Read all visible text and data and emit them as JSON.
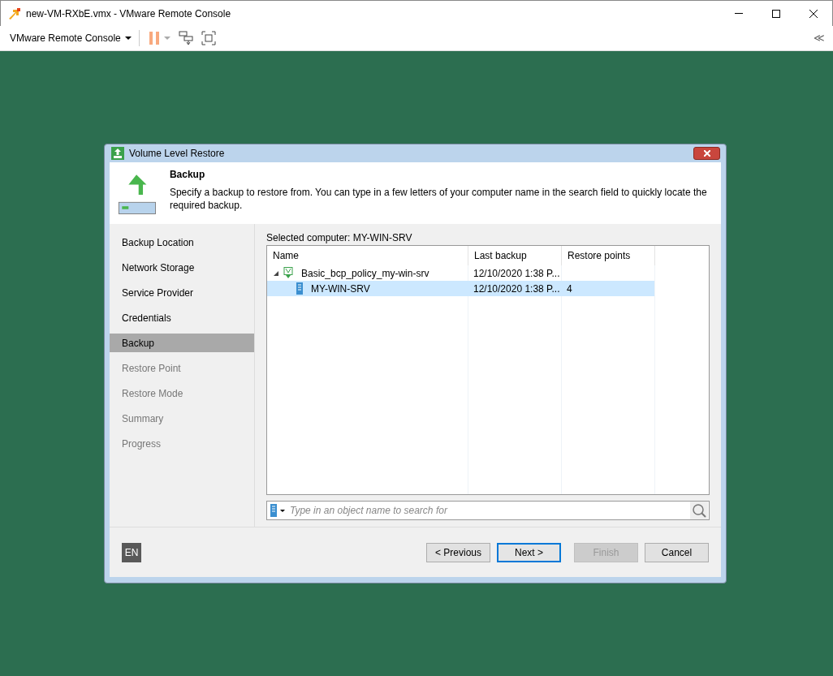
{
  "window": {
    "title": "new-VM-RXbE.vmx - VMware Remote Console"
  },
  "toolbar": {
    "menu_label": "VMware Remote Console",
    "collapse_glyph": "≪"
  },
  "dialog": {
    "title": "Volume Level Restore",
    "heading": "Backup",
    "description": "Specify a backup to restore from. You can type in a few letters of your computer name in the search field to quickly locate the required backup.",
    "steps": [
      {
        "label": "Backup Location",
        "selected": false,
        "disabled": false
      },
      {
        "label": "Network Storage",
        "selected": false,
        "disabled": false
      },
      {
        "label": "Service Provider",
        "selected": false,
        "disabled": false
      },
      {
        "label": "Credentials",
        "selected": false,
        "disabled": false
      },
      {
        "label": "Backup",
        "selected": true,
        "disabled": false
      },
      {
        "label": "Restore Point",
        "selected": false,
        "disabled": true
      },
      {
        "label": "Restore Mode",
        "selected": false,
        "disabled": true
      },
      {
        "label": "Summary",
        "selected": false,
        "disabled": true
      },
      {
        "label": "Progress",
        "selected": false,
        "disabled": true
      }
    ],
    "selected_computer": "Selected computer: MY-WIN-SRV",
    "table": {
      "columns": [
        "Name",
        "Last backup",
        "Restore points"
      ],
      "rows": [
        {
          "kind": "job",
          "name": "Basic_bcp_policy_my-win-srv",
          "last_backup": "12/10/2020 1:38 P...",
          "restore_points": "",
          "expanded": true,
          "selected": false,
          "children": [
            {
              "kind": "computer",
              "name": "MY-WIN-SRV",
              "last_backup": "12/10/2020 1:38 P...",
              "restore_points": "4",
              "selected": true
            }
          ]
        }
      ]
    },
    "search": {
      "placeholder": "Type in an object name to search for"
    },
    "language": "EN",
    "buttons": [
      {
        "label": "< Previous",
        "disabled": false,
        "default": false
      },
      {
        "label": "Next >",
        "disabled": false,
        "default": true
      },
      {
        "label": "Finish",
        "disabled": true,
        "default": false
      },
      {
        "label": "Cancel",
        "disabled": false,
        "default": false
      }
    ]
  }
}
